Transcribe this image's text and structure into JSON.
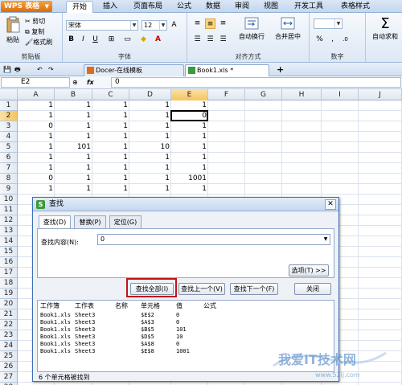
{
  "app": {
    "name": "WPS 表格"
  },
  "menu": {
    "tabs": [
      "开始",
      "插入",
      "页面布局",
      "公式",
      "数据",
      "审阅",
      "视图",
      "开发工具",
      "表格样式"
    ],
    "active": "开始"
  },
  "ribbon": {
    "paste": "粘贴",
    "cut": "剪切",
    "copy": "复制",
    "format_painter": "格式刷",
    "clipboard_group": "剪贴板",
    "font_name": "宋体",
    "font_size": "12",
    "font_group": "字体",
    "bold": "B",
    "italic": "I",
    "underline": "U",
    "wrap": "自动换行",
    "merge": "合并居中",
    "align_group": "对齐方式",
    "number_group": "数字",
    "percent": "%",
    "autosum": "自动求和"
  },
  "quickbar": {
    "tabs": [
      "Docer-在线模板",
      "Book1.xls *"
    ]
  },
  "formula_bar": {
    "name_box": "E2",
    "fx": "fx",
    "value": "0"
  },
  "sheet": {
    "columns": [
      "A",
      "B",
      "C",
      "D",
      "E",
      "F",
      "G",
      "H",
      "I",
      "J"
    ],
    "rows": [
      "1",
      "2",
      "3",
      "4",
      "5",
      "6",
      "7",
      "8",
      "9",
      "10",
      "11",
      "12",
      "13",
      "14",
      "15",
      "16",
      "17",
      "18",
      "19",
      "20",
      "21",
      "22",
      "23",
      "24",
      "25",
      "26",
      "27",
      "28"
    ],
    "active_col": "E",
    "active_row": "2",
    "cells": [
      [
        "1",
        "1",
        "1",
        "1",
        "1"
      ],
      [
        "1",
        "1",
        "1",
        "1",
        "0"
      ],
      [
        "0",
        "1",
        "1",
        "1",
        "1"
      ],
      [
        "1",
        "1",
        "1",
        "1",
        "1"
      ],
      [
        "1",
        "101",
        "1",
        "10",
        "1"
      ],
      [
        "1",
        "1",
        "1",
        "1",
        "1"
      ],
      [
        "1",
        "1",
        "1",
        "1",
        "1"
      ],
      [
        "0",
        "1",
        "1",
        "1",
        "1001"
      ],
      [
        "1",
        "1",
        "1",
        "1",
        "1"
      ]
    ]
  },
  "dialog": {
    "title": "查找",
    "tabs": [
      "查找(D)",
      "替换(P)",
      "定位(G)"
    ],
    "find_label": "查找内容(N):",
    "find_value": "0",
    "options_button": "选项(T) >>",
    "find_all": "查找全部(I)",
    "find_prev": "查找上一个(V)",
    "find_next": "查找下一个(F)",
    "close": "关闭",
    "result_headers": [
      "工作簿",
      "工作表",
      "名称",
      "单元格",
      "值",
      "公式"
    ],
    "results": [
      [
        "Book1.xls",
        "Sheet3",
        "",
        "$E$2",
        "0",
        ""
      ],
      [
        "Book1.xls",
        "Sheet3",
        "",
        "$A$3",
        "0",
        ""
      ],
      [
        "Book1.xls",
        "Sheet3",
        "",
        "$B$5",
        "101",
        ""
      ],
      [
        "Book1.xls",
        "Sheet3",
        "",
        "$D$5",
        "10",
        ""
      ],
      [
        "Book1.xls",
        "Sheet3",
        "",
        "$A$8",
        "0",
        ""
      ],
      [
        "Book1.xls",
        "Sheet3",
        "",
        "$E$8",
        "1001",
        ""
      ]
    ],
    "status": "6 个单元格被找到"
  },
  "watermark": {
    "text": "我爱IT技术网",
    "url": "www.52ij.com"
  },
  "colors": {
    "accent": "#3d6fb4",
    "highlight": "#c0141a",
    "active_header": "#f5c55f"
  }
}
